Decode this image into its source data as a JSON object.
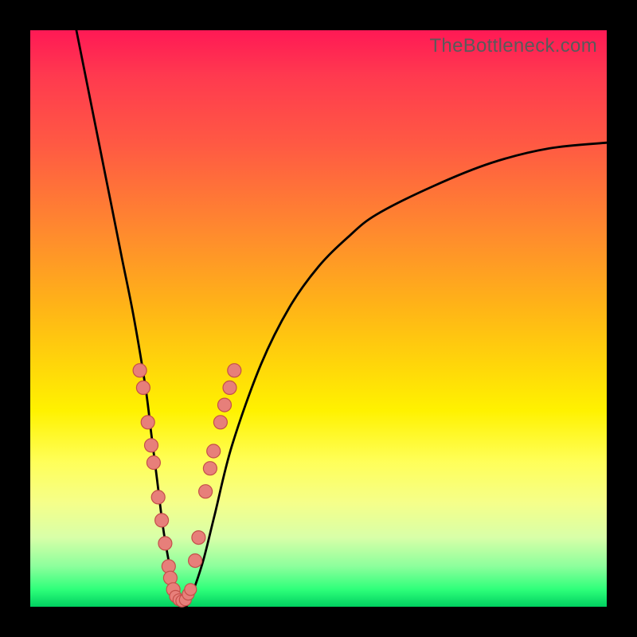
{
  "watermark": "TheBottleneck.com",
  "colors": {
    "dot_fill": "#e77f7a",
    "dot_stroke": "#c44f49",
    "curve": "#000000"
  },
  "chart_data": {
    "type": "line",
    "title": "",
    "xlabel": "",
    "ylabel": "",
    "xlim": [
      0,
      100
    ],
    "ylim": [
      0,
      100
    ],
    "x": [
      8,
      10,
      12,
      14,
      16,
      18,
      20,
      21,
      22,
      23,
      24,
      25,
      26,
      27,
      28,
      30,
      32,
      35,
      40,
      45,
      50,
      55,
      60,
      70,
      80,
      90,
      100
    ],
    "values": [
      100,
      90,
      80,
      70,
      60,
      50,
      38,
      30,
      22,
      14,
      8,
      3,
      0,
      0,
      2,
      8,
      16,
      28,
      42,
      52,
      59,
      64,
      68,
      73,
      77,
      79.5,
      80.5
    ],
    "series": [
      {
        "name": "bottleneck-curve",
        "x": [
          8,
          10,
          12,
          14,
          16,
          18,
          20,
          21,
          22,
          23,
          24,
          25,
          26,
          27,
          28,
          30,
          32,
          35,
          40,
          45,
          50,
          55,
          60,
          70,
          80,
          90,
          100
        ],
        "values": [
          100,
          90,
          80,
          70,
          60,
          50,
          38,
          30,
          22,
          14,
          8,
          3,
          0,
          0,
          2,
          8,
          16,
          28,
          42,
          52,
          59,
          64,
          68,
          73,
          77,
          79.5,
          80.5
        ]
      }
    ],
    "dots_left": [
      {
        "x": 19.0,
        "y": 41
      },
      {
        "x": 19.6,
        "y": 38
      },
      {
        "x": 20.4,
        "y": 32
      },
      {
        "x": 21.0,
        "y": 28
      },
      {
        "x": 21.4,
        "y": 25
      },
      {
        "x": 22.2,
        "y": 19
      },
      {
        "x": 22.8,
        "y": 15
      },
      {
        "x": 23.4,
        "y": 11
      },
      {
        "x": 24.0,
        "y": 7
      },
      {
        "x": 24.3,
        "y": 5
      },
      {
        "x": 24.8,
        "y": 3
      }
    ],
    "dots_bottom": [
      {
        "x": 25.2,
        "y": 1.8
      },
      {
        "x": 25.8,
        "y": 1.2
      },
      {
        "x": 26.3,
        "y": 1.0
      },
      {
        "x": 26.9,
        "y": 1.2
      },
      {
        "x": 27.4,
        "y": 2.2
      },
      {
        "x": 27.8,
        "y": 3.0
      }
    ],
    "dots_right": [
      {
        "x": 28.6,
        "y": 8
      },
      {
        "x": 29.2,
        "y": 12
      },
      {
        "x": 30.4,
        "y": 20
      },
      {
        "x": 31.2,
        "y": 24
      },
      {
        "x": 31.8,
        "y": 27
      },
      {
        "x": 33.0,
        "y": 32
      },
      {
        "x": 33.7,
        "y": 35
      },
      {
        "x": 34.6,
        "y": 38
      },
      {
        "x": 35.4,
        "y": 41
      }
    ]
  }
}
